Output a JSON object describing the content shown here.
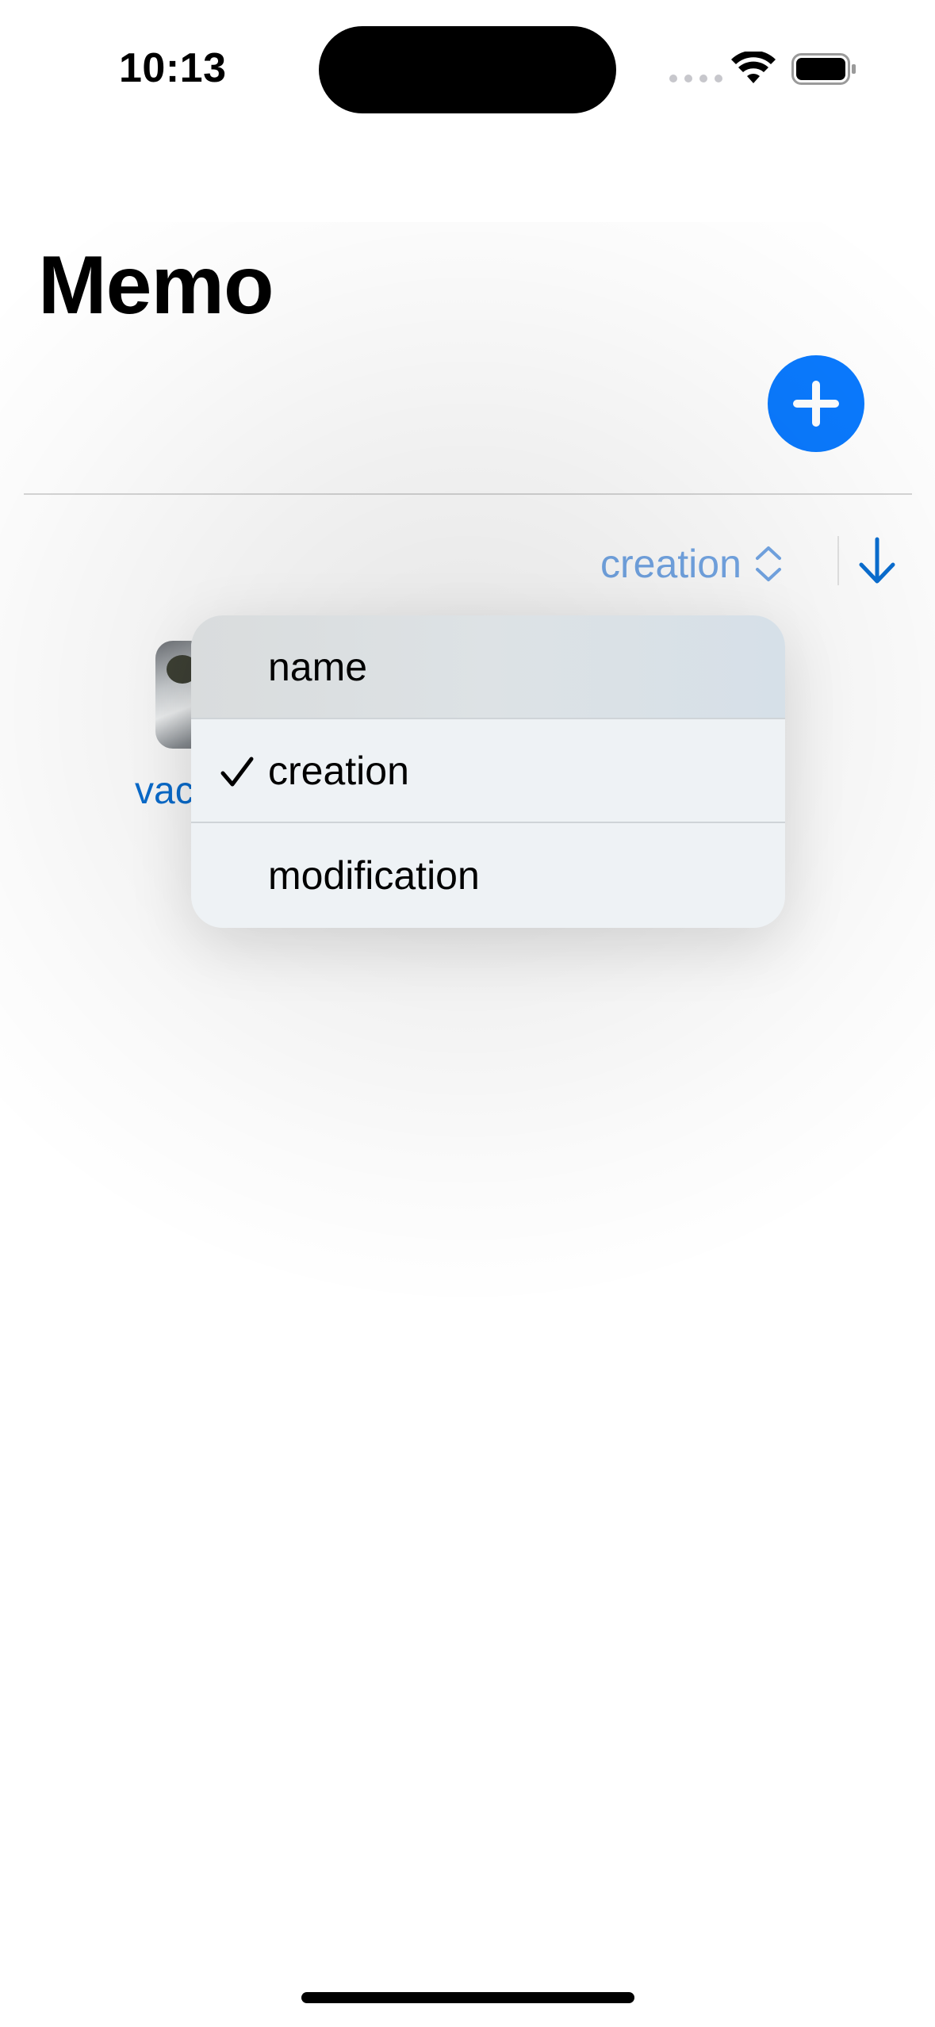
{
  "status_bar": {
    "time": "10:13"
  },
  "header": {
    "title": "Memo"
  },
  "toolbar": {
    "add_icon": "plus-icon",
    "sort_field": "creation",
    "sort_field_icon": "chevron-up-down-icon",
    "sort_direction_icon": "arrow-down-icon"
  },
  "memo_list": {
    "items": [
      {
        "label": "vac",
        "thumbnail": "waterfall-photo"
      }
    ]
  },
  "sort_menu": {
    "items": [
      {
        "label": "name",
        "checked": false
      },
      {
        "label": "creation",
        "checked": true
      },
      {
        "label": "modification",
        "checked": false
      }
    ]
  },
  "colors": {
    "accent": "#0a7aff",
    "link": "#0a6ed1",
    "picker_text": "#74a7e6",
    "menu_background": "#eef2f5"
  }
}
